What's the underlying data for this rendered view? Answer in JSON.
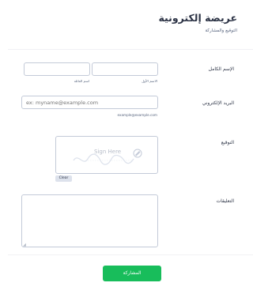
{
  "form": {
    "title": "عريضة إلكترونية",
    "subtitle": "التوقيع والمشاركة"
  },
  "fields": {
    "full_name": {
      "label": "الإسم الكامل",
      "first_sublabel": "الاسم الأول",
      "last_sublabel": "اسم العائلة",
      "first_value": "",
      "last_value": ""
    },
    "email": {
      "label": "البريد الإلكتروني",
      "placeholder": "ex: myname@example.com",
      "value": "",
      "hint": "example@example.com"
    },
    "signature": {
      "label": "التوقيع",
      "pad_text": "Sign Here",
      "clear_label": "Clear",
      "pen_icon": "pen-icon"
    },
    "comments": {
      "label": "التعليقات",
      "value": ""
    }
  },
  "submit": {
    "label": "المشاركة"
  },
  "colors": {
    "accent": "#18bd5b",
    "border": "#c3cad8",
    "text": "#2c3345"
  }
}
